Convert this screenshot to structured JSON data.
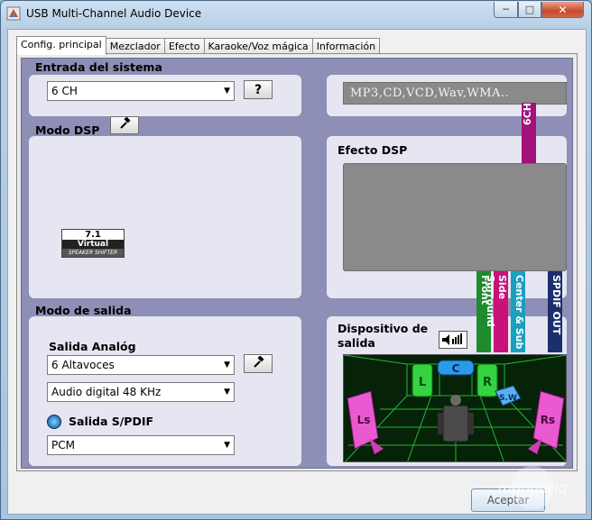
{
  "window": {
    "title": "USB Multi-Channel Audio Device"
  },
  "tabs": [
    {
      "label": "Config. principal"
    },
    {
      "label": "Mezclador"
    },
    {
      "label": "Efecto"
    },
    {
      "label": "Karaoke/Voz mágica"
    },
    {
      "label": "Información"
    }
  ],
  "system_input": {
    "heading": "Entrada del sistema",
    "select_value": "6 CH",
    "help_label": "?",
    "formats": "MP3,CD,VCD,Wav,WMA.."
  },
  "dsp_mode": {
    "heading": "Modo DSP",
    "virtual_badge": {
      "line1": "7.1",
      "line2": "Virtual",
      "line3": "SPEAKER SHIFTER"
    }
  },
  "dsp_effect": {
    "heading": "Efecto DSP"
  },
  "channel_bars": {
    "six_ch": "6CH",
    "front": "Front",
    "side_surround": "Side Surround",
    "center_sub": "Center & Sub",
    "spdif_out": "SPDIF OUT"
  },
  "output_mode": {
    "heading": "Modo de salida",
    "analog_label": "Salida Analóg",
    "speakers_value": "6 Altavoces",
    "digital_value": "Audio digital  48 KHz",
    "spdif_label": "Salida S/PDIF",
    "spdif_value": "PCM"
  },
  "device": {
    "heading_line1": "Dispositivo de",
    "heading_line2": "salida",
    "speakers": {
      "L": "L",
      "C": "C",
      "R": "R",
      "SW": "S.W",
      "Ls": "Ls",
      "Rs": "Rs"
    }
  },
  "footer": {
    "accept_label": "Aceptar"
  },
  "watermark": {
    "text": "mundoriq"
  },
  "colors": {
    "panel_bg": "#8e8fb6",
    "section_bg": "#e6e6f2",
    "six_ch": "#a3117a",
    "front": "#1f8a2e",
    "side_surround": "#c8127a",
    "center_sub": "#1b9fbf",
    "spdif_out": "#1b2f6e"
  }
}
